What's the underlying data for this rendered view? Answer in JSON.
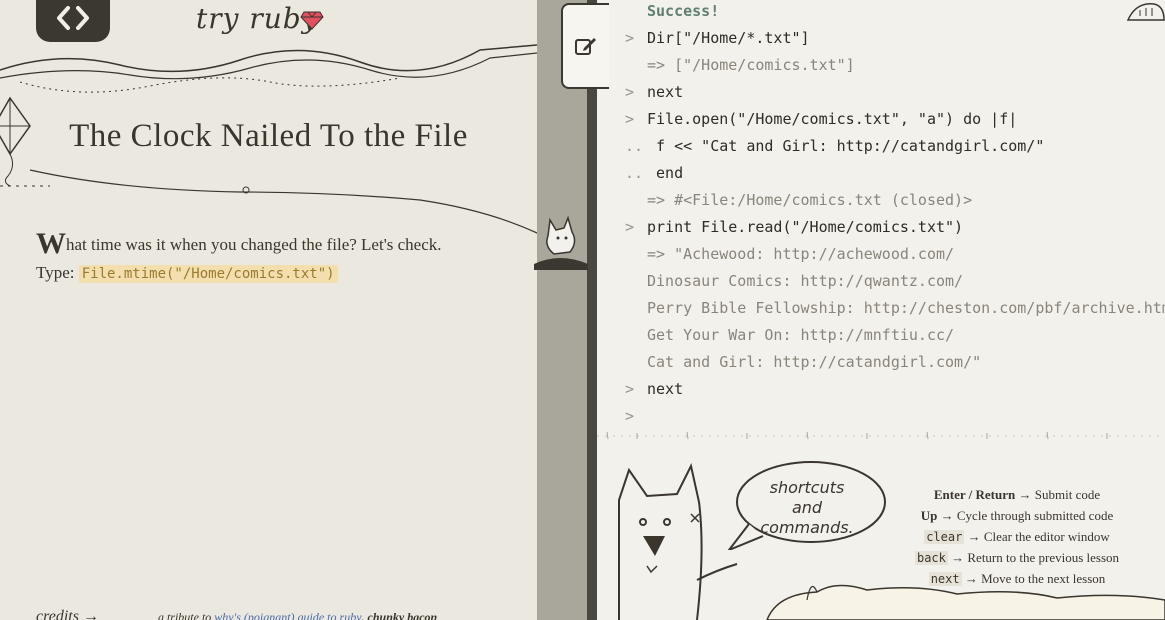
{
  "brand": {
    "name": "try ruby"
  },
  "lesson": {
    "title": "The Clock Nailed To the File",
    "dropcap": "W",
    "intro": "hat time was it when you changed the file? Let's check.",
    "type_label": "Type:",
    "code": "File.mtime(\"/Home/comics.txt\")"
  },
  "footer": {
    "credits": "credits →",
    "tribute_prefix": "a tribute to",
    "tribute_link": "why's (poignant) guide to ruby",
    "tribute_suffix": ", chunky bacon"
  },
  "console": {
    "lines": [
      {
        "prompt": "",
        "text": "Success!",
        "kind": "success"
      },
      {
        "prompt": ">",
        "text": "Dir[\"/Home/*.txt\"]",
        "kind": "cmd"
      },
      {
        "prompt": "",
        "text": "=> [\"/Home/comics.txt\"]",
        "kind": "out"
      },
      {
        "prompt": ">",
        "text": "next",
        "kind": "cmd"
      },
      {
        "prompt": ">",
        "text": "File.open(\"/Home/comics.txt\", \"a\") do |f|",
        "kind": "cmd"
      },
      {
        "prompt": "..",
        "text": " f << \"Cat and Girl: http://catandgirl.com/\"",
        "kind": "cmd"
      },
      {
        "prompt": "..",
        "text": " end",
        "kind": "cmd"
      },
      {
        "prompt": "",
        "text": "=> #<File:/Home/comics.txt (closed)>",
        "kind": "out"
      },
      {
        "prompt": ">",
        "text": "print File.read(\"/Home/comics.txt\")",
        "kind": "cmd"
      },
      {
        "prompt": "",
        "text": "=> \"Achewood: http://achewood.com/",
        "kind": "out"
      },
      {
        "prompt": "",
        "text": "Dinosaur Comics: http://qwantz.com/",
        "kind": "out"
      },
      {
        "prompt": "",
        "text": "Perry Bible Fellowship: http://cheston.com/pbf/archive.html",
        "kind": "out"
      },
      {
        "prompt": "",
        "text": "Get Your War On: http://mnftiu.cc/",
        "kind": "out"
      },
      {
        "prompt": "",
        "text": "Cat and Girl: http://catandgirl.com/\"",
        "kind": "out"
      },
      {
        "prompt": ">",
        "text": "next",
        "kind": "cmd"
      },
      {
        "prompt": ">",
        "text": "",
        "kind": "cmd"
      }
    ]
  },
  "help": {
    "bubble_lines": [
      "shortcuts",
      "and",
      "commands."
    ],
    "shortcuts": [
      {
        "key": "Enter / Return",
        "desc": "→ Submit code",
        "chip": false
      },
      {
        "key": "Up",
        "desc": "→ Cycle through submitted code",
        "chip": false
      },
      {
        "key": "clear",
        "desc": "→ Clear the editor window",
        "chip": true
      },
      {
        "key": "back",
        "desc": "→ Return to the previous lesson",
        "chip": true
      },
      {
        "key": "next",
        "desc": "→ Move to the next lesson",
        "chip": true
      }
    ]
  },
  "colors": {
    "panel_bg": "#ebe8df",
    "console_bg": "#f3f1ec",
    "divider": "#a9a69c",
    "dark": "#3b3832",
    "code_chip_bg": "#f3dfae",
    "ruby": "#e0505e",
    "link": "#4a6aa8"
  }
}
